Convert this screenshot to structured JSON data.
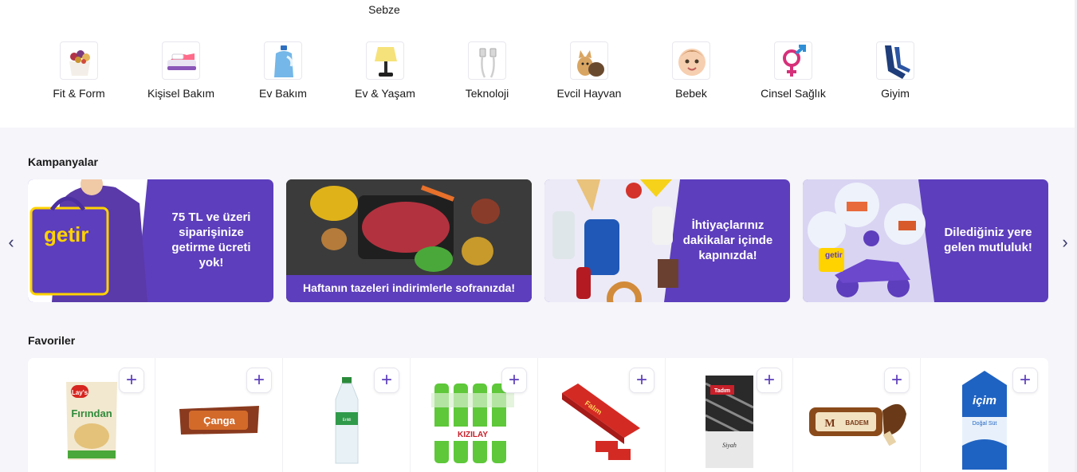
{
  "header": {
    "partial_category_label": "Sebze"
  },
  "categories": [
    {
      "label": "Fit & Form",
      "icon": "yogurt-granola-icon"
    },
    {
      "label": "Kişisel Bakım",
      "icon": "toothbrush-icon"
    },
    {
      "label": "Ev Bakım",
      "icon": "detergent-bottle-icon"
    },
    {
      "label": "Ev & Yaşam",
      "icon": "lamp-icon"
    },
    {
      "label": "Teknoloji",
      "icon": "usb-cable-icon"
    },
    {
      "label": "Evcil Hayvan",
      "icon": "pets-icon"
    },
    {
      "label": "Bebek",
      "icon": "baby-icon"
    },
    {
      "label": "Cinsel Sağlık",
      "icon": "gender-symbols-icon"
    },
    {
      "label": "Giyim",
      "icon": "stockings-icon"
    }
  ],
  "campaigns": {
    "title": "Kampanyalar",
    "prev_icon": "chevron-left-icon",
    "next_icon": "chevron-right-icon",
    "banners": [
      {
        "text": "75 TL ve üzeri siparişinize getirme ücreti yok!",
        "logo": "getir"
      },
      {
        "text": "Haftanın tazeleri indirimlerle sofranızda!"
      },
      {
        "text": "İhtiyaçlarınız dakikalar içinde kapınızda!"
      },
      {
        "text": "Dilediğiniz yere gelen mutluluk!",
        "logo": "getir"
      }
    ]
  },
  "favorites": {
    "title": "Favoriler",
    "add_label": "+",
    "products": [
      {
        "icon": "chips-bag-icon",
        "brand": "Lay's",
        "name": "Fırından"
      },
      {
        "icon": "chocolate-bar-icon",
        "brand": "Çanga"
      },
      {
        "icon": "water-bottle-icon",
        "brand": "Erikli"
      },
      {
        "icon": "mineral-water-pack-icon",
        "brand": "KIZILAY"
      },
      {
        "icon": "chewing-gum-pack-icon",
        "brand": "Falım"
      },
      {
        "icon": "sunflower-seeds-icon",
        "brand": "Tadım",
        "name": "Siyah"
      },
      {
        "icon": "ice-cream-icon",
        "brand": "M",
        "name": "BADEM"
      },
      {
        "icon": "milk-carton-icon",
        "brand": "içim",
        "name": "Doğal Süt"
      }
    ]
  },
  "colors": {
    "brand_purple": "#5d3ebc",
    "brand_yellow": "#ffd300",
    "background": "#f5f5fa"
  }
}
